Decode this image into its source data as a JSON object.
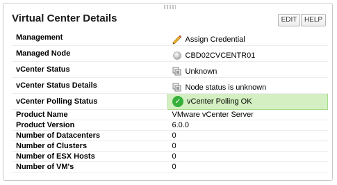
{
  "panel": {
    "title": "Virtual Center Details",
    "edit_label": "EDIT",
    "help_label": "HELP"
  },
  "rows": [
    {
      "label": "Management",
      "value": "Assign Credential",
      "icon": "pencil-icon"
    },
    {
      "label": "Managed Node",
      "value": "CBD02CVCENTR01",
      "icon": "node-status-dot-icon"
    },
    {
      "label": "vCenter Status",
      "value": "Unknown",
      "icon": "unknown-status-icon"
    },
    {
      "label": "vCenter Status Details",
      "value": "Node status is unknown",
      "icon": "unknown-status-icon"
    },
    {
      "label": "vCenter Polling Status",
      "value": "vCenter Polling OK",
      "icon": "check-circle-icon"
    },
    {
      "label": "Product Name",
      "value": "VMware vCenter Server"
    },
    {
      "label": "Product Version",
      "value": "6.0.0"
    },
    {
      "label": "Number of Datacenters",
      "value": "0"
    },
    {
      "label": "Number of Clusters",
      "value": "0"
    },
    {
      "label": "Number of ESX Hosts",
      "value": "0"
    },
    {
      "label": "Number of VM's",
      "value": "0"
    }
  ],
  "colors": {
    "highlight_bg": "#d4f0c2",
    "ok_green": "#36b03a"
  }
}
